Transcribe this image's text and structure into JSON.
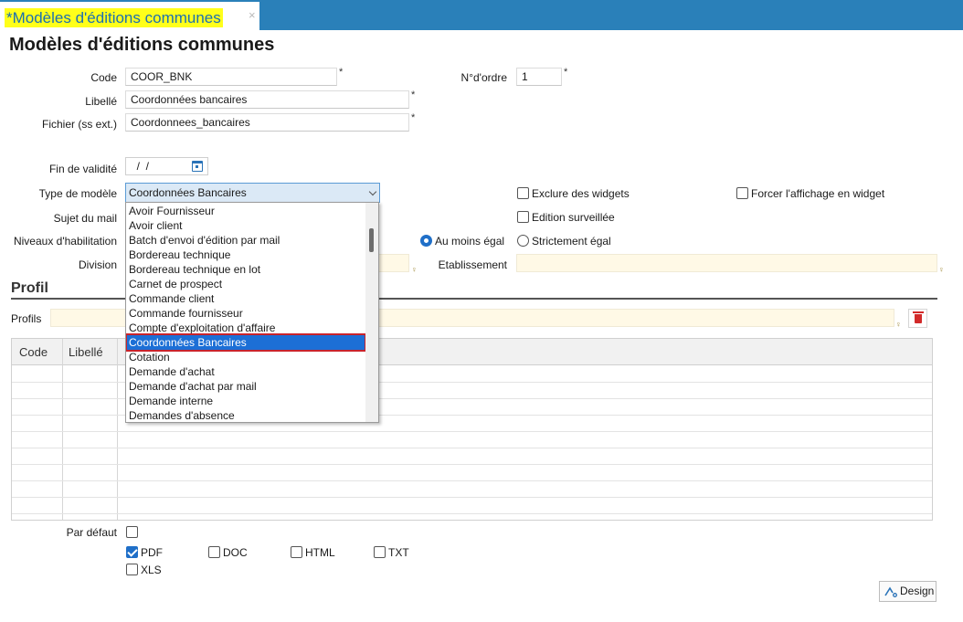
{
  "tab": {
    "label": "*Modèles d'éditions communes",
    "close": "×"
  },
  "page_title": "Modèles d'éditions communes",
  "required_mark": "*",
  "form": {
    "code": {
      "label": "Code",
      "value": "COOR_BNK"
    },
    "ordre": {
      "label": "N°d'ordre",
      "value": "1"
    },
    "libelle": {
      "label": "Libellé",
      "value": "Coordonnées bancaires"
    },
    "fichier": {
      "label": "Fichier (ss ext.)",
      "value": "Coordonnees_bancaires"
    },
    "fin_validite": {
      "label": "Fin de validité",
      "value": "  /  /"
    },
    "type_modele": {
      "label": "Type de modèle",
      "value": "Coordonnées Bancaires"
    },
    "sujet_mail": {
      "label": "Sujet du mail"
    },
    "niveaux": {
      "label": "Niveaux d'habilitation"
    },
    "division": {
      "label": "Division"
    },
    "etablissement": {
      "label": "Etablissement"
    },
    "exclure_widgets": {
      "label": "Exclure des widgets",
      "checked": false
    },
    "forcer_widget": {
      "label": "Forcer l'affichage en widget",
      "checked": false
    },
    "edition_surveillee": {
      "label": "Edition surveillée",
      "checked": false
    },
    "au_moins_egal": {
      "label": "Au moins égal",
      "selected": true
    },
    "strictement_egal": {
      "label": "Strictement égal",
      "selected": false
    }
  },
  "profil": {
    "title": "Profil",
    "profils_label": "Profils",
    "columns": [
      "Code",
      "Libellé"
    ]
  },
  "options": {
    "par_defaut": {
      "label": "Par défaut",
      "checked": false
    },
    "pdf": {
      "label": "PDF",
      "checked": true
    },
    "doc": {
      "label": "DOC",
      "checked": false
    },
    "html": {
      "label": "HTML",
      "checked": false
    },
    "txt": {
      "label": "TXT",
      "checked": false
    },
    "xls": {
      "label": "XLS",
      "checked": false
    }
  },
  "design_button": "Design",
  "dropdown": {
    "items": [
      "Avoir Fournisseur",
      "Avoir client",
      "Batch d'envoi d'édition par mail",
      "Bordereau technique",
      "Bordereau technique en lot",
      "Carnet de prospect",
      "Commande client",
      "Commande fournisseur",
      "Compte d'exploitation d'affaire",
      "Coordonnées Bancaires",
      "Cotation",
      "Demande d'achat",
      "Demande d'achat par mail",
      "Demande interne",
      "Demandes d'absence"
    ],
    "selected": "Coordonnées Bancaires"
  },
  "colors": {
    "tabbar": "#2a80b9",
    "highlight_tab": "#ffff1a",
    "selection": "#1c6fd6",
    "selection_outline": "#c8232c",
    "lookup_bg": "#fff9e6"
  }
}
